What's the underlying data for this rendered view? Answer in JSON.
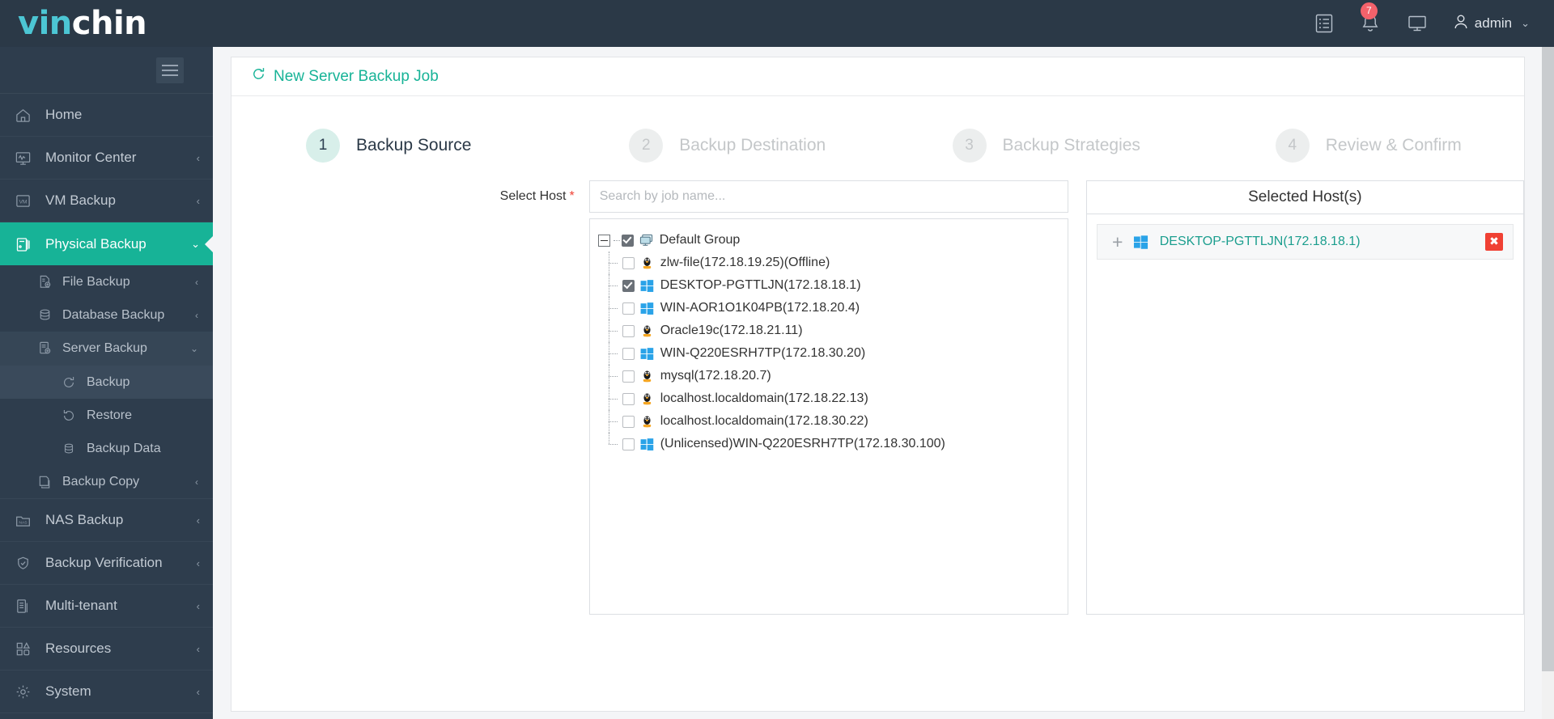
{
  "brand": {
    "part1": "vin",
    "part2": "chin"
  },
  "header": {
    "notifications_count": "7",
    "user": "admin",
    "chevron": "⌄",
    "icons": {
      "logs": "list-icon",
      "bell": "bell-icon",
      "display": "monitor-icon",
      "user": "user-icon"
    }
  },
  "sidebar": {
    "toggle": "hamburger-icon",
    "items": [
      {
        "label": "Home",
        "icon": "home-icon",
        "arrow": ""
      },
      {
        "label": "Monitor Center",
        "icon": "monitor-icon",
        "arrow": "‹"
      },
      {
        "label": "VM Backup",
        "icon": "vm-icon",
        "arrow": "‹"
      },
      {
        "label": "Physical Backup",
        "icon": "server-icon",
        "arrow": "⌄",
        "active": true
      }
    ],
    "physical_children": [
      {
        "label": "File Backup",
        "icon": "file-backup-icon",
        "arrow": "‹",
        "level": 2
      },
      {
        "label": "Database Backup",
        "icon": "database-icon",
        "arrow": "‹",
        "level": 2
      },
      {
        "label": "Server Backup",
        "icon": "server-backup-icon",
        "arrow": "⌄",
        "level": 2,
        "open": true
      },
      {
        "label": "Backup",
        "icon": "refresh-icon",
        "arrow": "",
        "level": 3,
        "selected": true
      },
      {
        "label": "Restore",
        "icon": "restore-icon",
        "arrow": "",
        "level": 3
      },
      {
        "label": "Backup Data",
        "icon": "database-icon",
        "arrow": "",
        "level": 3
      },
      {
        "label": "Backup Copy",
        "icon": "copy-icon",
        "arrow": "‹",
        "level": 2
      }
    ],
    "items_bottom": [
      {
        "label": "NAS Backup",
        "icon": "nas-icon",
        "arrow": "‹"
      },
      {
        "label": "Backup Verification",
        "icon": "shield-check-icon",
        "arrow": "‹"
      },
      {
        "label": "Multi-tenant",
        "icon": "tenant-icon",
        "arrow": "‹"
      },
      {
        "label": "Resources",
        "icon": "resources-icon",
        "arrow": "‹"
      },
      {
        "label": "System",
        "icon": "gear-icon",
        "arrow": "‹"
      }
    ]
  },
  "page": {
    "title": "New Server Backup Job",
    "title_icon": "refresh-icon"
  },
  "steps": [
    {
      "num": "1",
      "label": "Backup Source",
      "active": true
    },
    {
      "num": "2",
      "label": "Backup Destination",
      "active": false
    },
    {
      "num": "3",
      "label": "Backup Strategies",
      "active": false
    },
    {
      "num": "4",
      "label": "Review & Confirm",
      "active": false
    }
  ],
  "form": {
    "select_host_label": "Select Host",
    "required_mark": "*",
    "search_placeholder": "Search by job name...",
    "search_value": ""
  },
  "tree": {
    "root": {
      "label": "Default Group",
      "icon": "group-icon",
      "checked": true,
      "expanded": true
    },
    "nodes": [
      {
        "label": "zlw-file(172.18.19.25)(Offline)",
        "os": "linux",
        "checked": false
      },
      {
        "label": "DESKTOP-PGTTLJN(172.18.18.1)",
        "os": "windows",
        "checked": true
      },
      {
        "label": "WIN-AOR1O1K04PB(172.18.20.4)",
        "os": "windows",
        "checked": false
      },
      {
        "label": "Oracle19c(172.18.21.11)",
        "os": "linux",
        "checked": false
      },
      {
        "label": "WIN-Q220ESRH7TP(172.18.30.20)",
        "os": "windows",
        "checked": false
      },
      {
        "label": "mysql(172.18.20.7)",
        "os": "linux",
        "checked": false
      },
      {
        "label": "localhost.localdomain(172.18.22.13)",
        "os": "linux",
        "checked": false
      },
      {
        "label": "localhost.localdomain(172.18.30.22)",
        "os": "linux",
        "checked": false
      },
      {
        "label": "(Unlicensed)WIN-Q220ESRH7TP(172.18.30.100)",
        "os": "windows",
        "checked": false
      }
    ]
  },
  "selected_panel": {
    "title": "Selected Host(s)",
    "hosts": [
      {
        "name": "DESKTOP-PGTTLJN(172.18.18.1)",
        "os": "windows",
        "expand": "+",
        "remove": "✖"
      }
    ]
  },
  "colors": {
    "brand_teal": "#17b397",
    "logo_teal": "#4cc6d4",
    "topbar": "#2b3947",
    "sidebar": "#2e3d4d",
    "badge_red": "#f4626b",
    "remove_red": "#f04134",
    "link_teal": "#1b9e8e",
    "windows_blue": "#2aa3e8"
  }
}
